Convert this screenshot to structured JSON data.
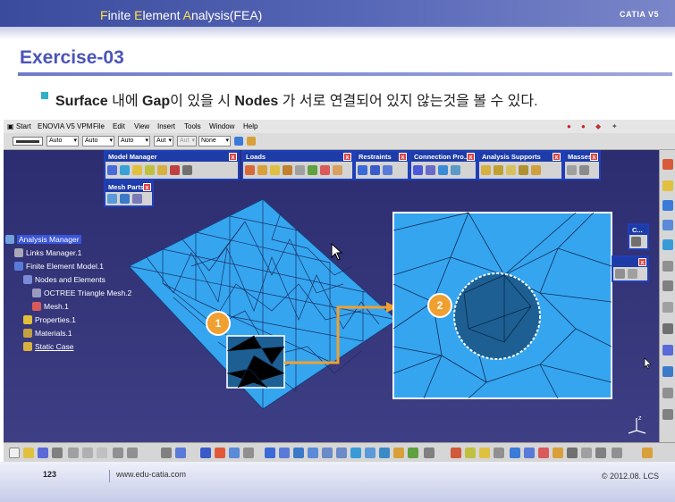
{
  "slide": {
    "header_title_parts": [
      "F",
      "inite ",
      "E",
      "lement ",
      "A",
      "nalysis(FEA)"
    ],
    "brand": "CATIA V5",
    "exercise_title": "Exercise-03",
    "subtitle": {
      "t1": "Surface",
      "t2": " 내에 ",
      "t3": "Gap",
      "t4": "이 있을 시 ",
      "t5": "Nodes",
      "t6": " 가 서로 연결되어 있지 않는것을 볼 수 있다."
    },
    "footer": {
      "page_number": "123",
      "url": "www.edu-catia.com",
      "copyright": "© 2012.08. LCS"
    }
  },
  "catia": {
    "menu": [
      "Start",
      "ENOVIA V5 VPM",
      "File",
      "Edit",
      "View",
      "Insert",
      "Tools",
      "Window",
      "Help"
    ],
    "properties": {
      "combo1": "Auto",
      "combo2": "Auto",
      "combo3": "Auto",
      "combo4": "Aut",
      "combo5": "Aut",
      "combo6": "None"
    },
    "toolbars": {
      "model_manager": "Model Manager",
      "mesh_parts": "Mesh Parts",
      "loads": "Loads",
      "restraints": "Restraints",
      "connection_properties": "Connection Pro...",
      "analysis_supports": "Analysis Supports",
      "masses": "Masses",
      "partial_c": "C..."
    },
    "tree": {
      "root": "Analysis Manager",
      "links": "Links Manager.1",
      "fem": "Finite Element Model.1",
      "nodes": "Nodes and Elements",
      "octree": "OCTREE Triangle Mesh.2",
      "mesh": "Mesh.1",
      "properties": "Properties.1",
      "materials": "Materials.1",
      "static": "Static Case"
    },
    "callouts": {
      "one": "1",
      "two": "2"
    }
  },
  "colors": {
    "header_blue": "#3a4a9c",
    "title_blue": "#4a55b8",
    "mesh_fill": "#35a5f0",
    "gap_fill": "#1d5f92",
    "callout_orange": "#f0a030",
    "toolbar_border": "#1f3fb8",
    "viewport_bg": "#32327a"
  }
}
